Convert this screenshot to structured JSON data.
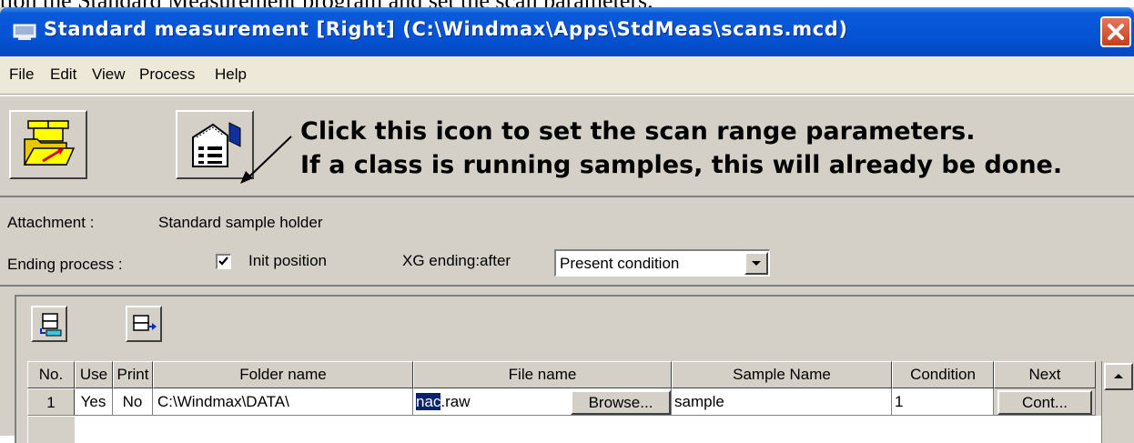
{
  "caption": "tion the Standard Measurement program and set the scan parameters.",
  "window": {
    "title": "Standard measurement [Right] (C:\\Windmax\\Apps\\StdMeas\\scans.mcd)"
  },
  "menu": [
    "File",
    "Edit",
    "View",
    "Process",
    "Help"
  ],
  "callout": {
    "line1": "Click this icon to set the scan range parameters.",
    "line2": "If a class is running samples, this will already be done."
  },
  "attachment": {
    "label": "Attachment :",
    "value": "Standard sample holder"
  },
  "ending": {
    "label": "Ending process :",
    "init_position_label": "Init position",
    "init_position_checked": true,
    "xg_label": "XG ending:after",
    "xg_value": "Present condition"
  },
  "table": {
    "headers": [
      "No.",
      "Use",
      "Print",
      "Folder name",
      "File name",
      "Sample Name",
      "Condition",
      "Next"
    ],
    "rows": [
      {
        "no": "1",
        "use": "Yes",
        "print": "No",
        "folder": "C:\\Windmax\\DATA\\",
        "file_selected": "nac",
        "file_rest": ".raw",
        "browse_label": "Browse...",
        "sample": "sample",
        "condition": "1",
        "next_label": "Cont..."
      }
    ]
  },
  "colors": {
    "titlebar": "#0553d6",
    "selection": "#0a246a",
    "close": "#c53f1e"
  },
  "icons": [
    "window-icon",
    "close-icon",
    "open-folder-icon",
    "scan-parameters-icon",
    "insert-row-icon",
    "append-row-icon",
    "dropdown-arrow-icon",
    "scroll-up-arrow-icon",
    "checkmark-icon"
  ]
}
